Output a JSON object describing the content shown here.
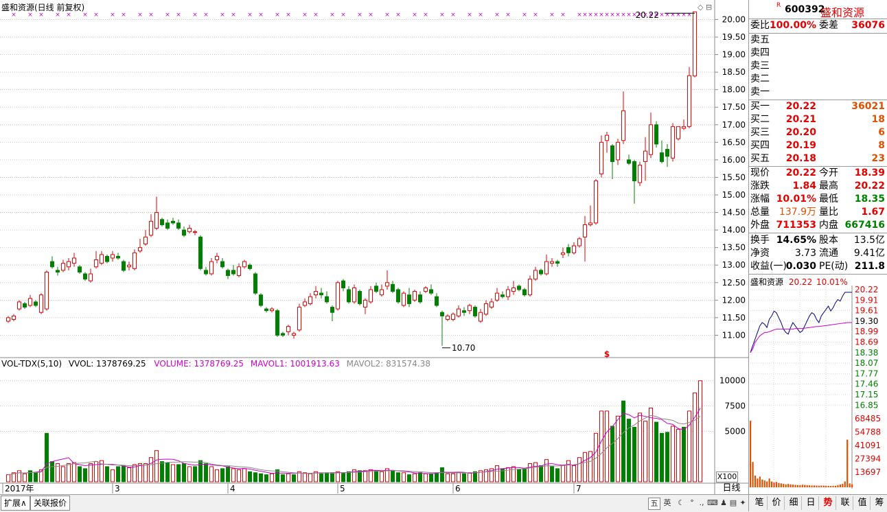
{
  "stock": {
    "code": "600392",
    "name": "盛和资源",
    "r_mark": "R"
  },
  "chart": {
    "title": "盛和资源(日线 前复权)",
    "high_label": "20.22",
    "low_label": "10.70",
    "price_ticks": [
      "20.00",
      "19.50",
      "19.00",
      "18.50",
      "18.00",
      "17.50",
      "17.00",
      "16.50",
      "16.00",
      "15.50",
      "15.00",
      "14.50",
      "14.00",
      "13.50",
      "13.00",
      "12.50",
      "12.00",
      "11.50",
      "11.00"
    ],
    "date_labels": [
      "2017年",
      "3",
      "4",
      "5",
      "6",
      "7"
    ],
    "dollar_mark": "$",
    "vol_header": {
      "name": "VOL-TDX(5,10)",
      "vvol": "VVOL: 1378769.25",
      "volume": "VOLUME: 1378769.25",
      "mavol1": "MAVOL1: 1001913.63",
      "mavol2": "MAVOL2: 831574.38"
    },
    "vol_ticks": [
      "10000",
      "7500",
      "5000"
    ],
    "vol_unit": "X100",
    "period": "日线"
  },
  "chart_data": {
    "type": "candlestick",
    "ylim": [
      10.5,
      20.4
    ],
    "candles": [
      [
        11.4,
        11.5,
        11.35,
        11.55
      ],
      [
        11.45,
        11.55,
        11.4,
        11.6
      ],
      [
        11.75,
        11.95,
        11.7,
        12.0
      ],
      [
        11.9,
        11.8,
        11.75,
        11.95
      ],
      [
        11.85,
        12.05,
        11.8,
        12.15
      ],
      [
        11.95,
        11.85,
        11.8,
        12.0
      ],
      [
        11.65,
        12.15,
        11.6,
        12.2
      ],
      [
        11.75,
        12.8,
        11.7,
        12.85
      ],
      [
        13.1,
        12.95,
        12.9,
        13.25
      ],
      [
        12.85,
        12.8,
        12.7,
        12.95
      ],
      [
        12.85,
        13.05,
        12.8,
        13.15
      ],
      [
        12.95,
        13.1,
        12.85,
        13.2
      ],
      [
        13.05,
        13.2,
        12.95,
        13.35
      ],
      [
        12.95,
        12.8,
        12.75,
        13.0
      ],
      [
        12.75,
        12.6,
        12.55,
        12.8
      ],
      [
        12.55,
        12.75,
        12.5,
        12.9
      ],
      [
        12.95,
        13.15,
        12.9,
        13.4
      ],
      [
        13.05,
        13.3,
        13.0,
        13.4
      ],
      [
        13.25,
        13.1,
        13.05,
        13.3
      ],
      [
        13.2,
        13.3,
        13.1,
        13.4
      ],
      [
        13.25,
        13.2,
        13.15,
        13.35
      ],
      [
        13.1,
        12.85,
        12.8,
        13.15
      ],
      [
        12.95,
        13.0,
        12.85,
        13.1
      ],
      [
        12.9,
        13.35,
        12.85,
        13.45
      ],
      [
        13.4,
        13.5,
        13.35,
        13.75
      ],
      [
        13.6,
        13.8,
        13.55,
        14.0
      ],
      [
        13.85,
        14.25,
        13.8,
        14.45
      ],
      [
        14.05,
        14.5,
        14.0,
        14.95
      ],
      [
        14.3,
        14.15,
        14.1,
        14.35
      ],
      [
        14.2,
        14.05,
        14.0,
        14.3
      ],
      [
        14.25,
        14.2,
        14.15,
        14.35
      ],
      [
        14.2,
        14.05,
        14.0,
        14.3
      ],
      [
        14.0,
        13.85,
        13.8,
        14.1
      ],
      [
        13.95,
        14.05,
        13.9,
        14.15
      ],
      [
        13.95,
        13.95,
        13.85,
        14.0
      ],
      [
        13.8,
        12.9,
        12.85,
        13.85
      ],
      [
        12.85,
        12.75,
        12.7,
        12.95
      ],
      [
        12.75,
        13.1,
        12.7,
        13.2
      ],
      [
        13.15,
        13.25,
        13.05,
        13.35
      ],
      [
        13.1,
        12.95,
        12.9,
        13.2
      ],
      [
        12.85,
        12.7,
        12.6,
        12.9
      ],
      [
        12.85,
        12.75,
        12.7,
        13.0
      ],
      [
        12.7,
        12.95,
        12.65,
        13.05
      ],
      [
        12.95,
        13.1,
        12.9,
        13.15
      ],
      [
        13.0,
        12.9,
        12.85,
        13.05
      ],
      [
        12.75,
        12.2,
        12.15,
        12.8
      ],
      [
        12.15,
        11.85,
        11.8,
        12.2
      ],
      [
        11.75,
        11.7,
        11.65,
        11.8
      ],
      [
        11.7,
        11.75,
        11.65,
        11.8
      ],
      [
        11.7,
        11.0,
        10.95,
        11.75
      ],
      [
        11.05,
        11.0,
        10.95,
        11.1
      ],
      [
        11.1,
        11.25,
        11.0,
        11.3
      ],
      [
        11.0,
        11.05,
        10.9,
        11.1
      ],
      [
        11.15,
        11.8,
        11.1,
        11.9
      ],
      [
        11.85,
        11.95,
        11.8,
        12.05
      ],
      [
        11.9,
        12.1,
        11.85,
        12.2
      ],
      [
        12.15,
        12.25,
        12.05,
        12.4
      ],
      [
        12.2,
        12.15,
        12.05,
        12.35
      ],
      [
        12.1,
        11.95,
        11.9,
        12.25
      ],
      [
        11.8,
        11.65,
        11.4,
        11.85
      ],
      [
        11.75,
        12.5,
        11.7,
        12.55
      ],
      [
        12.55,
        12.35,
        12.25,
        12.6
      ],
      [
        12.3,
        11.95,
        11.9,
        12.4
      ],
      [
        11.95,
        12.35,
        11.9,
        12.45
      ],
      [
        12.25,
        11.9,
        11.85,
        12.3
      ],
      [
        11.8,
        12.0,
        11.6,
        12.05
      ],
      [
        11.95,
        12.3,
        11.9,
        12.4
      ],
      [
        12.4,
        12.25,
        12.2,
        12.5
      ],
      [
        12.15,
        12.3,
        12.1,
        12.45
      ],
      [
        12.4,
        12.5,
        12.3,
        12.85
      ],
      [
        12.45,
        12.25,
        12.2,
        12.55
      ],
      [
        12.3,
        11.95,
        11.9,
        12.35
      ],
      [
        11.85,
        12.2,
        11.8,
        12.25
      ],
      [
        12.15,
        11.9,
        11.8,
        12.35
      ],
      [
        12.0,
        12.25,
        11.95,
        12.3
      ],
      [
        12.15,
        11.95,
        11.9,
        12.25
      ],
      [
        12.25,
        12.35,
        12.2,
        12.4
      ],
      [
        12.3,
        12.2,
        12.15,
        12.45
      ],
      [
        12.1,
        11.85,
        11.8,
        12.2
      ],
      [
        11.65,
        11.55,
        10.7,
        11.7
      ],
      [
        11.45,
        11.55,
        11.4,
        11.6
      ],
      [
        11.45,
        11.6,
        11.4,
        11.65
      ],
      [
        11.55,
        11.75,
        11.5,
        11.85
      ],
      [
        11.7,
        11.65,
        11.55,
        11.8
      ],
      [
        11.7,
        11.85,
        11.6,
        11.9
      ],
      [
        11.8,
        11.55,
        11.5,
        11.85
      ],
      [
        11.4,
        11.65,
        11.35,
        11.75
      ],
      [
        11.6,
        11.9,
        11.55,
        12.0
      ],
      [
        11.8,
        11.95,
        11.75,
        12.05
      ],
      [
        12.0,
        12.2,
        11.95,
        12.35
      ],
      [
        12.15,
        12.1,
        12.05,
        12.25
      ],
      [
        12.1,
        12.3,
        12.0,
        12.4
      ],
      [
        12.25,
        12.35,
        12.15,
        12.55
      ],
      [
        12.4,
        12.3,
        12.25,
        12.45
      ],
      [
        12.3,
        12.15,
        12.1,
        12.35
      ],
      [
        12.15,
        12.6,
        12.1,
        12.7
      ],
      [
        12.6,
        12.85,
        12.55,
        12.95
      ],
      [
        12.85,
        12.75,
        12.7,
        12.9
      ],
      [
        12.75,
        13.1,
        12.7,
        13.3
      ],
      [
        13.05,
        13.1,
        12.95,
        13.2
      ],
      [
        13.1,
        13.05,
        12.95,
        13.15
      ],
      [
        13.3,
        13.35,
        13.2,
        13.5
      ],
      [
        13.5,
        13.35,
        13.25,
        13.6
      ],
      [
        13.35,
        13.55,
        13.3,
        13.65
      ],
      [
        13.55,
        13.75,
        13.5,
        13.8
      ],
      [
        13.8,
        14.15,
        13.1,
        14.4
      ],
      [
        14.15,
        14.2,
        14.1,
        14.7
      ],
      [
        14.2,
        15.4,
        14.15,
        15.45
      ],
      [
        15.6,
        16.5,
        15.5,
        16.7
      ],
      [
        16.55,
        16.7,
        16.2,
        16.8
      ],
      [
        16.4,
        15.95,
        15.45,
        16.45
      ],
      [
        16.0,
        16.5,
        15.85,
        16.6
      ],
      [
        16.55,
        17.4,
        16.45,
        17.95
      ],
      [
        16.0,
        15.9,
        15.85,
        16.15
      ],
      [
        15.95,
        15.4,
        14.75,
        16.0
      ],
      [
        15.35,
        15.85,
        15.25,
        15.95
      ],
      [
        15.95,
        16.25,
        15.4,
        16.65
      ],
      [
        16.15,
        17.0,
        16.05,
        17.35
      ],
      [
        17.0,
        16.45,
        16.35,
        17.1
      ],
      [
        16.2,
        15.95,
        15.9,
        16.55
      ],
      [
        16.3,
        16.1,
        15.8,
        16.45
      ],
      [
        16.05,
        16.95,
        15.95,
        17.05
      ],
      [
        16.6,
        16.95,
        16.55,
        16.95
      ],
      [
        16.9,
        16.95,
        16.85,
        17.15
      ],
      [
        16.95,
        18.4,
        16.9,
        18.65
      ],
      [
        18.39,
        20.22,
        18.35,
        20.22
      ]
    ],
    "volumes": [
      [
        700,
        1
      ],
      [
        900,
        1
      ],
      [
        1100,
        1
      ],
      [
        800,
        1
      ],
      [
        1100,
        0
      ],
      [
        900,
        0
      ],
      [
        1200,
        1
      ],
      [
        4800,
        0
      ],
      [
        2000,
        0
      ],
      [
        1800,
        1
      ],
      [
        1500,
        1
      ],
      [
        1800,
        1
      ],
      [
        1900,
        1
      ],
      [
        1500,
        0
      ],
      [
        1300,
        0
      ],
      [
        1800,
        1
      ],
      [
        2000,
        1
      ],
      [
        2100,
        1
      ],
      [
        1500,
        0
      ],
      [
        1200,
        1
      ],
      [
        1500,
        0
      ],
      [
        1600,
        0
      ],
      [
        1400,
        1
      ],
      [
        1700,
        1
      ],
      [
        1800,
        1
      ],
      [
        1800,
        1
      ],
      [
        2400,
        1
      ],
      [
        3100,
        1
      ],
      [
        2000,
        0
      ],
      [
        1900,
        0
      ],
      [
        1700,
        1
      ],
      [
        1700,
        0
      ],
      [
        1800,
        0
      ],
      [
        1500,
        1
      ],
      [
        1500,
        0
      ],
      [
        2100,
        0
      ],
      [
        1800,
        0
      ],
      [
        1500,
        1
      ],
      [
        1200,
        1
      ],
      [
        1300,
        0
      ],
      [
        1500,
        0
      ],
      [
        1300,
        1
      ],
      [
        1200,
        1
      ],
      [
        1300,
        1
      ],
      [
        1000,
        0
      ],
      [
        900,
        0
      ],
      [
        800,
        0
      ],
      [
        700,
        0
      ],
      [
        800,
        1
      ],
      [
        1200,
        0
      ],
      [
        700,
        0
      ],
      [
        800,
        1
      ],
      [
        700,
        0
      ],
      [
        1000,
        1
      ],
      [
        900,
        1
      ],
      [
        800,
        1
      ],
      [
        1000,
        1
      ],
      [
        800,
        0
      ],
      [
        900,
        0
      ],
      [
        900,
        0
      ],
      [
        1000,
        1
      ],
      [
        900,
        0
      ],
      [
        1000,
        0
      ],
      [
        1200,
        1
      ],
      [
        1100,
        0
      ],
      [
        1100,
        1
      ],
      [
        1200,
        1
      ],
      [
        1100,
        0
      ],
      [
        1000,
        1
      ],
      [
        1300,
        1
      ],
      [
        1100,
        0
      ],
      [
        900,
        0
      ],
      [
        900,
        1
      ],
      [
        700,
        0
      ],
      [
        800,
        1
      ],
      [
        900,
        0
      ],
      [
        800,
        1
      ],
      [
        800,
        0
      ],
      [
        900,
        0
      ],
      [
        1400,
        0
      ],
      [
        800,
        1
      ],
      [
        800,
        1
      ],
      [
        900,
        1
      ],
      [
        800,
        0
      ],
      [
        900,
        1
      ],
      [
        1000,
        0
      ],
      [
        1100,
        1
      ],
      [
        1200,
        1
      ],
      [
        1300,
        1
      ],
      [
        1600,
        1
      ],
      [
        1300,
        0
      ],
      [
        1400,
        1
      ],
      [
        1500,
        1
      ],
      [
        1200,
        0
      ],
      [
        1300,
        0
      ],
      [
        1800,
        1
      ],
      [
        1900,
        1
      ],
      [
        1600,
        0
      ],
      [
        2200,
        1
      ],
      [
        1500,
        0
      ],
      [
        1300,
        0
      ],
      [
        1600,
        1
      ],
      [
        2100,
        1
      ],
      [
        1600,
        1
      ],
      [
        2400,
        1
      ],
      [
        2900,
        1
      ],
      [
        3000,
        1
      ],
      [
        4800,
        1
      ],
      [
        7000,
        1
      ],
      [
        7000,
        1
      ],
      [
        5500,
        0
      ],
      [
        6500,
        1
      ],
      [
        8000,
        0
      ],
      [
        6200,
        0
      ],
      [
        5400,
        0
      ],
      [
        6800,
        1
      ],
      [
        6000,
        1
      ],
      [
        7300,
        1
      ],
      [
        5900,
        0
      ],
      [
        4800,
        0
      ],
      [
        4900,
        0
      ],
      [
        5500,
        1
      ],
      [
        5200,
        1
      ],
      [
        5400,
        0
      ],
      [
        7000,
        1
      ],
      [
        8800,
        1
      ],
      [
        10000,
        1
      ]
    ],
    "vol_ylim": [
      0,
      11000
    ],
    "intraday_ylim": [
      18.3,
      20.3
    ],
    "intraday_price": [
      18.39,
      18.6,
      18.8,
      19.0,
      19.2,
      19.3,
      19.25,
      19.15,
      19.4,
      19.5,
      19.65,
      19.6,
      19.45,
      19.3,
      19.1,
      19.0,
      18.95,
      19.15,
      19.3,
      19.2,
      19.1,
      19.0,
      19.05,
      19.2,
      19.35,
      19.5,
      19.6,
      19.55,
      19.4,
      19.3,
      19.5,
      19.6,
      19.7,
      19.8,
      19.65,
      19.75,
      19.9,
      20.0,
      19.95,
      20.1,
      20.22,
      20.22,
      20.22,
      20.22
    ],
    "intraday_avg": [
      18.39,
      18.5,
      18.7,
      18.8,
      18.9,
      18.95,
      19.0,
      19.0,
      19.02,
      19.05,
      19.08,
      19.1,
      19.1,
      19.1,
      19.1,
      19.1,
      19.1,
      19.1,
      19.1,
      19.12,
      19.12,
      19.12,
      19.12,
      19.13,
      19.14,
      19.15,
      19.16,
      19.17,
      19.18,
      19.18,
      19.19,
      19.2,
      19.21,
      19.22,
      19.23,
      19.24,
      19.25,
      19.26,
      19.27,
      19.28,
      19.29,
      19.3,
      19.3,
      19.3
    ],
    "intraday_vol": [
      68485,
      26000,
      12000,
      9000,
      11000,
      8000,
      7000,
      6000,
      9000,
      6000,
      5000,
      5500,
      4500,
      4000,
      3500,
      3000,
      3500,
      3000,
      2800,
      2500,
      2300,
      2200,
      2600,
      2400,
      2200,
      2000,
      1800,
      1900,
      1700,
      1600,
      1800,
      1700,
      1600,
      1500,
      1400,
      1600,
      1500,
      2200,
      2800,
      3500,
      6000,
      49000,
      4000,
      3000
    ]
  },
  "quote": {
    "weibi": {
      "label": "委比",
      "value": "100.00%",
      "label2": "委差",
      "value2": "36076"
    },
    "sells": [
      {
        "label": "卖五"
      },
      {
        "label": "卖四"
      },
      {
        "label": "卖三"
      },
      {
        "label": "卖二"
      },
      {
        "label": "卖一"
      }
    ],
    "buys": [
      {
        "label": "买一",
        "price": "20.22",
        "vol": "36021"
      },
      {
        "label": "买二",
        "price": "20.21",
        "vol": "18"
      },
      {
        "label": "买三",
        "price": "20.20",
        "vol": "6"
      },
      {
        "label": "买四",
        "price": "20.19",
        "vol": "8"
      },
      {
        "label": "买五",
        "price": "20.18",
        "vol": "23"
      }
    ],
    "stats": [
      {
        "l1": "现价",
        "v1": "20.22",
        "l2": "今开",
        "v2": "18.39"
      },
      {
        "l1": "涨跌",
        "v1": "1.84",
        "l2": "最高",
        "v2": "20.22"
      },
      {
        "l1": "涨幅",
        "v1": "10.01%",
        "l2": "最低",
        "v2": "18.35"
      },
      {
        "l1": "总量",
        "v1": "137.9万",
        "l2": "量比",
        "v2": "1.67"
      },
      {
        "l1": "外盘",
        "v1": "711353",
        "l2": "内盘",
        "v2": "667416"
      }
    ],
    "fund": [
      {
        "l1": "换手",
        "v1": "14.65%",
        "l2": "股本",
        "v2": "13.5亿"
      },
      {
        "l1": "净资",
        "v1": "3.73",
        "l2": "流通",
        "v2": "9.41亿"
      },
      {
        "l1": "收益(一)",
        "v1": "0.030",
        "l2": "PE(动)",
        "v2": "211.8"
      }
    ]
  },
  "mini": {
    "title_name": "盛和资源",
    "title_price": "20.22",
    "title_pct": "10.01%",
    "price_ticks": [
      "20.22",
      "19.91",
      "19.61",
      "19.30",
      "18.99",
      "18.69",
      "18.38",
      "18.07",
      "17.77",
      "17.46",
      "17.15",
      "16.85"
    ],
    "vol_ticks": [
      "68485",
      "54788",
      "41091",
      "27394",
      "13697"
    ]
  },
  "bottom_tabs": [
    "扩展∧",
    "关联报价"
  ],
  "panel_tabs": [
    "笔",
    "价",
    "细",
    "日",
    "势",
    "联",
    "值",
    "筹"
  ],
  "tray": {
    "items": [
      "五",
      "英"
    ]
  },
  "colors": {
    "up": "#e60000",
    "down": "#008000",
    "ma1": "#cc00cc",
    "ma2": "#888888",
    "bg": "#ffffff"
  }
}
